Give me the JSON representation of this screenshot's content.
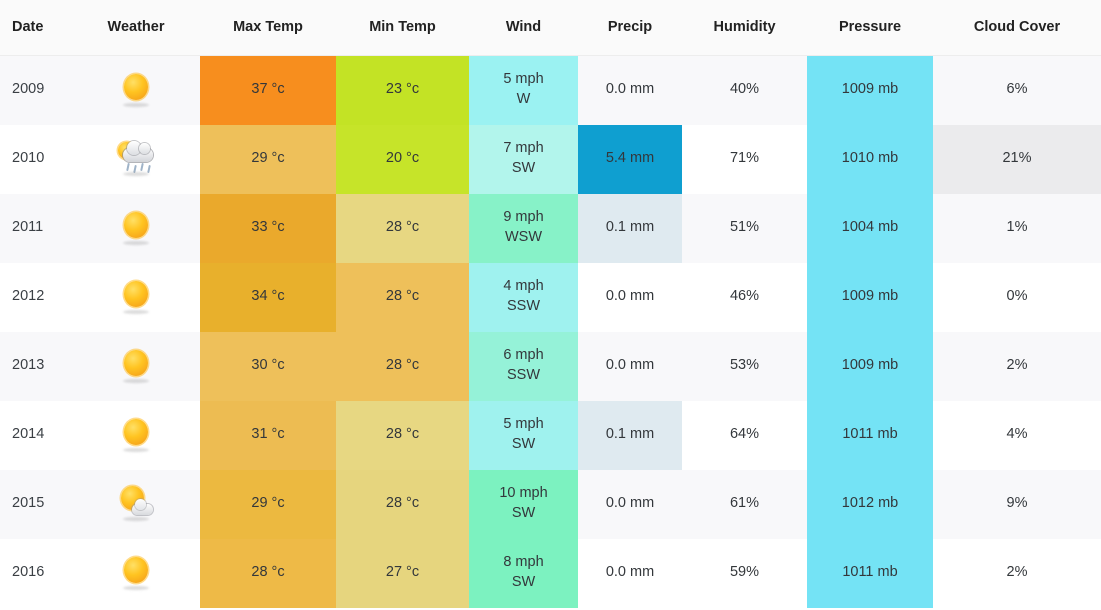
{
  "table": {
    "columns": [
      {
        "key": "date",
        "label": "Date"
      },
      {
        "key": "weather",
        "label": "Weather"
      },
      {
        "key": "max_temp",
        "label": "Max Temp"
      },
      {
        "key": "min_temp",
        "label": "Min Temp"
      },
      {
        "key": "wind",
        "label": "Wind"
      },
      {
        "key": "precip",
        "label": "Precip"
      },
      {
        "key": "humidity",
        "label": "Humidity"
      },
      {
        "key": "pressure",
        "label": "Pressure"
      },
      {
        "key": "cloud",
        "label": "Cloud Cover"
      }
    ],
    "rows": [
      {
        "date": "2009",
        "weather_icon": "sun-icon",
        "max_temp": "37 °c",
        "max_temp_color": "#f78e1e",
        "min_temp": "23 °c",
        "min_temp_color": "#c3e325",
        "wind": "5 mph\nW",
        "wind_color": "#9bf2f2",
        "precip": "0.0 mm",
        "precip_color": "",
        "humidity": "40%",
        "humidity_color": "",
        "pressure": "1009 mb",
        "pressure_color": "#74e3f5",
        "cloud": "6%",
        "cloud_color": ""
      },
      {
        "date": "2010",
        "weather_icon": "rain-icon",
        "max_temp": "29 °c",
        "max_temp_color": "#eec05a",
        "min_temp": "20 °c",
        "min_temp_color": "#c6e429",
        "wind": "7 mph\nSW",
        "wind_color": "#b2f5ec",
        "precip": "5.4 mm",
        "precip_color": "#0f9fd0",
        "humidity": "71%",
        "humidity_color": "",
        "pressure": "1010 mb",
        "pressure_color": "#74e3f5",
        "cloud": "21%",
        "cloud_color": "#ebebed"
      },
      {
        "date": "2011",
        "weather_icon": "sun-icon",
        "max_temp": "33 °c",
        "max_temp_color": "#eaa92c",
        "min_temp": "28 °c",
        "min_temp_color": "#e7d782",
        "wind": "9 mph\nWSW",
        "wind_color": "#87f2c8",
        "precip": "0.1 mm",
        "precip_color": "#dfeaf0",
        "humidity": "51%",
        "humidity_color": "",
        "pressure": "1004 mb",
        "pressure_color": "#74e3f5",
        "cloud": "1%",
        "cloud_color": ""
      },
      {
        "date": "2012",
        "weather_icon": "sun-icon",
        "max_temp": "34 °c",
        "max_temp_color": "#e8b02c",
        "min_temp": "28 °c",
        "min_temp_color": "#eec05a",
        "wind": "4 mph\nSSW",
        "wind_color": "#9ff2ef",
        "precip": "0.0 mm",
        "precip_color": "",
        "humidity": "46%",
        "humidity_color": "",
        "pressure": "1009 mb",
        "pressure_color": "#74e3f5",
        "cloud": "0%",
        "cloud_color": ""
      },
      {
        "date": "2013",
        "weather_icon": "sun-icon",
        "max_temp": "30 °c",
        "max_temp_color": "#eec05a",
        "min_temp": "28 °c",
        "min_temp_color": "#eec05a",
        "wind": "6 mph\nSSW",
        "wind_color": "#95f2d8",
        "precip": "0.0 mm",
        "precip_color": "",
        "humidity": "53%",
        "humidity_color": "",
        "pressure": "1009 mb",
        "pressure_color": "#74e3f5",
        "cloud": "2%",
        "cloud_color": ""
      },
      {
        "date": "2014",
        "weather_icon": "sun-icon",
        "max_temp": "31 °c",
        "max_temp_color": "#edbc52",
        "min_temp": "28 °c",
        "min_temp_color": "#e7d782",
        "wind": "5 mph\nSW",
        "wind_color": "#9ff2ee",
        "precip": "0.1 mm",
        "precip_color": "#dfeaf0",
        "humidity": "64%",
        "humidity_color": "",
        "pressure": "1011 mb",
        "pressure_color": "#74e3f5",
        "cloud": "4%",
        "cloud_color": ""
      },
      {
        "date": "2015",
        "weather_icon": "partly-cloudy-icon",
        "max_temp": "29 °c",
        "max_temp_color": "#ecb940",
        "min_temp": "28 °c",
        "min_temp_color": "#e6d57e",
        "wind": "10 mph\nSW",
        "wind_color": "#7cf2c0",
        "precip": "0.0 mm",
        "precip_color": "",
        "humidity": "61%",
        "humidity_color": "",
        "pressure": "1012 mb",
        "pressure_color": "#74e3f5",
        "cloud": "9%",
        "cloud_color": ""
      },
      {
        "date": "2016",
        "weather_icon": "sun-icon",
        "max_temp": "28 °c",
        "max_temp_color": "#eeba47",
        "min_temp": "27 °c",
        "min_temp_color": "#e6d57e",
        "wind": "8 mph\nSW",
        "wind_color": "#7cf2c0",
        "precip": "0.0 mm",
        "precip_color": "",
        "humidity": "59%",
        "humidity_color": "",
        "pressure": "1011 mb",
        "pressure_color": "#74e3f5",
        "cloud": "2%",
        "cloud_color": ""
      }
    ]
  }
}
